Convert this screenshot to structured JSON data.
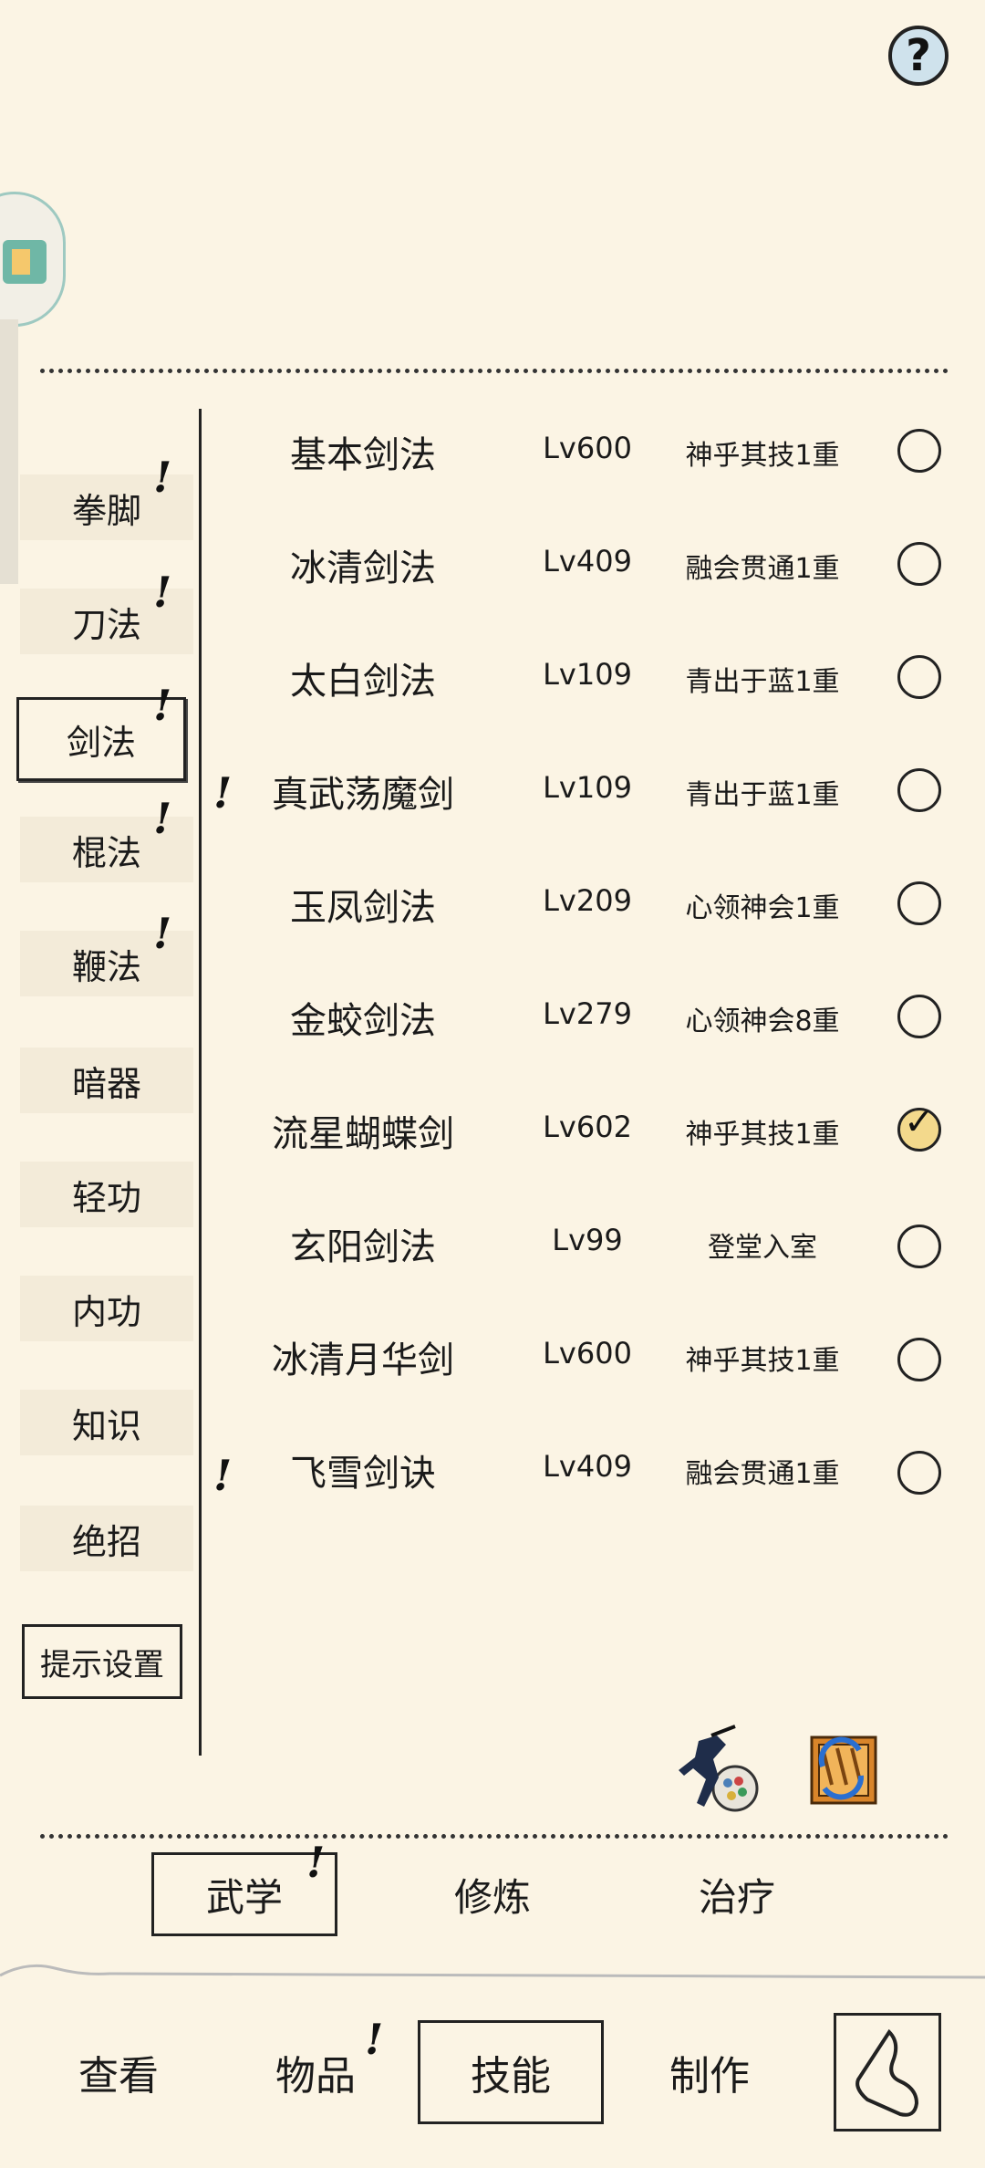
{
  "help_label": "?",
  "categories": [
    {
      "label": "拳脚",
      "alert": "!"
    },
    {
      "label": "刀法",
      "alert": "!"
    },
    {
      "label": "剑法",
      "alert": "!"
    },
    {
      "label": "棍法",
      "alert": "!"
    },
    {
      "label": "鞭法",
      "alert": "!"
    },
    {
      "label": "暗器",
      "alert": ""
    },
    {
      "label": "轻功",
      "alert": ""
    },
    {
      "label": "内功",
      "alert": ""
    },
    {
      "label": "知识",
      "alert": ""
    },
    {
      "label": "绝招",
      "alert": ""
    }
  ],
  "hint_settings_label": "提示设置",
  "skills": [
    {
      "name": "基本剑法",
      "level": "Lv600",
      "rank": "神乎其技1重",
      "alert": "",
      "selected": false
    },
    {
      "name": "冰清剑法",
      "level": "Lv409",
      "rank": "融会贯通1重",
      "alert": "",
      "selected": false
    },
    {
      "name": "太白剑法",
      "level": "Lv109",
      "rank": "青出于蓝1重",
      "alert": "",
      "selected": false
    },
    {
      "name": "真武荡魔剑",
      "level": "Lv109",
      "rank": "青出于蓝1重",
      "alert": "!",
      "selected": false
    },
    {
      "name": "玉凤剑法",
      "level": "Lv209",
      "rank": "心领神会1重",
      "alert": "",
      "selected": false
    },
    {
      "name": "金蛟剑法",
      "level": "Lv279",
      "rank": "心领神会8重",
      "alert": "",
      "selected": false
    },
    {
      "name": "流星蝴蝶剑",
      "level": "Lv602",
      "rank": "神乎其技1重",
      "alert": "",
      "selected": true
    },
    {
      "name": "玄阳剑法",
      "level": "Lv99",
      "rank": "登堂入室",
      "alert": "",
      "selected": false
    },
    {
      "name": "冰清月华剑",
      "level": "Lv600",
      "rank": "神乎其技1重",
      "alert": "",
      "selected": false
    },
    {
      "name": "飞雪剑诀",
      "level": "Lv409",
      "rank": "融会贯通1重",
      "alert": "!",
      "selected": false
    }
  ],
  "subtabs": [
    {
      "label": "武学",
      "alert": "!"
    },
    {
      "label": "修炼",
      "alert": ""
    },
    {
      "label": "治疗",
      "alert": ""
    }
  ],
  "nav": [
    {
      "label": "查看",
      "alert": ""
    },
    {
      "label": "物品",
      "alert": "!"
    },
    {
      "label": "技能",
      "alert": ""
    },
    {
      "label": "制作",
      "alert": ""
    }
  ],
  "check_mark": "✓"
}
